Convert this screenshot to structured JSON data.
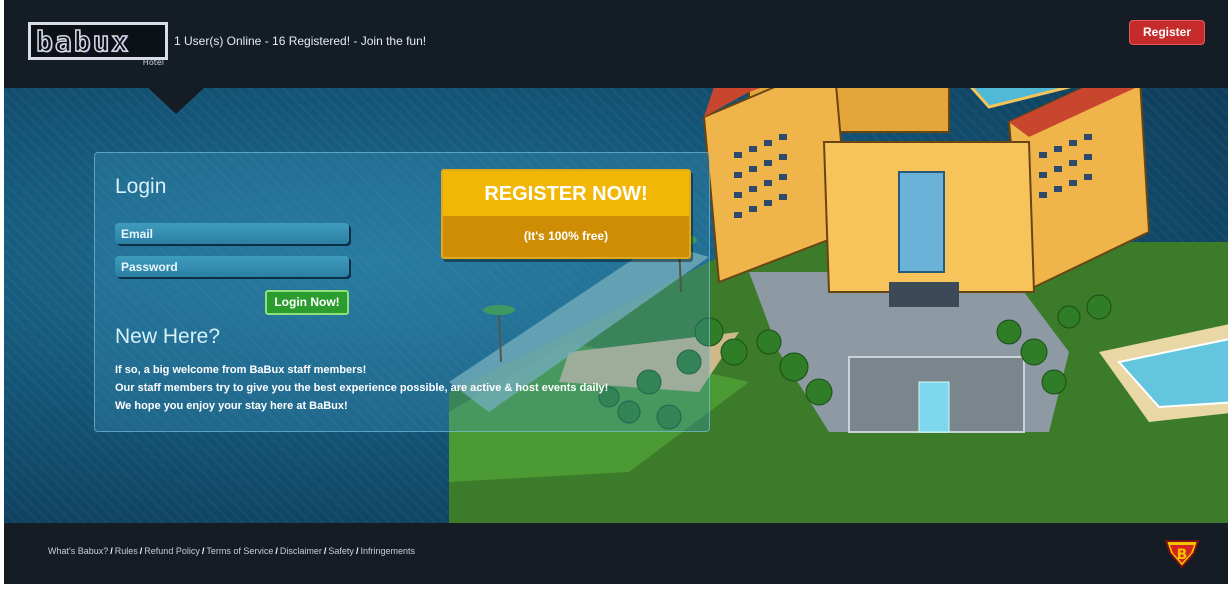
{
  "header": {
    "logo_text": "babux",
    "logo_subtext": "Hotel",
    "online_status": "1 User(s) Online - 16 Registered! - Join the fun!",
    "register_label": "Register"
  },
  "login": {
    "title": "Login",
    "email_placeholder": "Email",
    "password_placeholder": "Password",
    "submit_label": "Login Now!"
  },
  "register_cta": {
    "title": "REGISTER NOW!",
    "subtitle": "(It's 100% free)"
  },
  "new_here": {
    "title": "New Here?",
    "lines": [
      "If so, a big welcome from BaBux staff members!",
      "Our staff members try to give you the best experience possible, are active & host events daily!",
      "We hope you enjoy your stay here at BaBux!"
    ]
  },
  "footer": {
    "links": [
      "What's Babux?",
      "Rules",
      "Refund Policy",
      "Terms of Service",
      "Disclaimer",
      "Safety",
      "Infringements"
    ]
  },
  "colors": {
    "header_bg": "#141c26",
    "main_bg": "#145476",
    "register_red": "#c62b2b",
    "cta_gold": "#f2b705",
    "login_green": "#2b9d2f"
  },
  "icons": {
    "logo": "babux-logo-icon",
    "footer_badge": "superhero-b-badge-icon"
  }
}
